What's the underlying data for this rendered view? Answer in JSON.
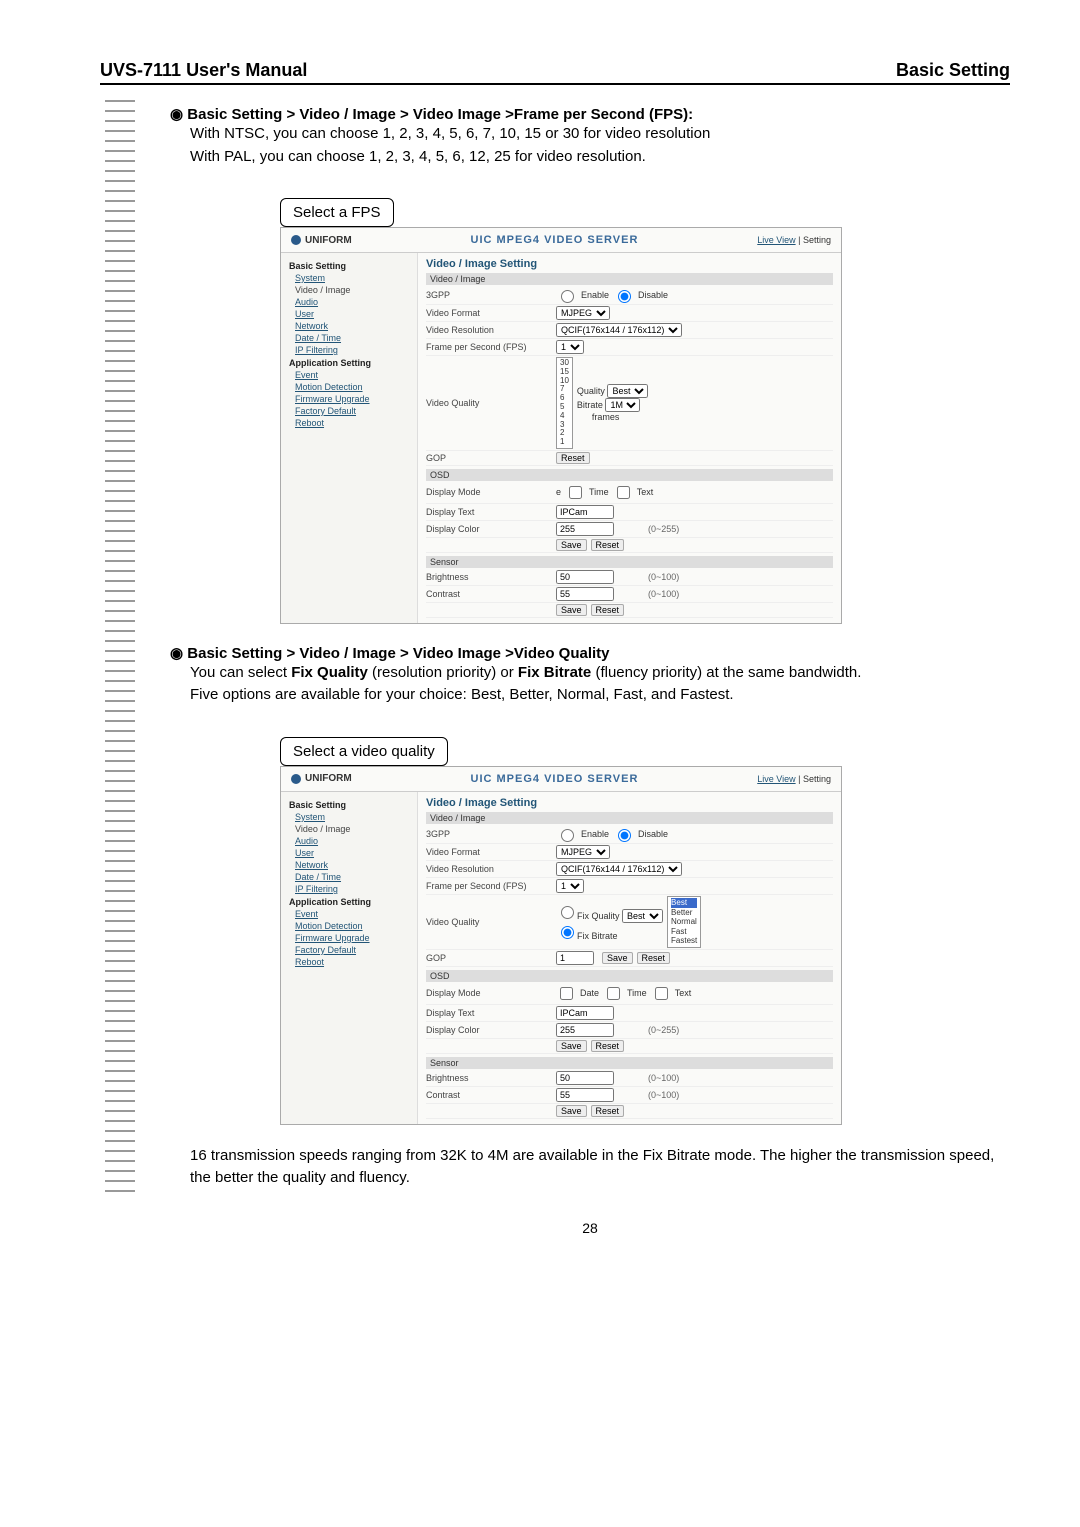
{
  "header": {
    "left": "UVS-7111 User's Manual",
    "right": "Basic Setting"
  },
  "fps_section": {
    "title": "Basic Setting > Video / Image > Video Image >Frame per Second (FPS):",
    "line1": "With NTSC, you can choose 1, 2, 3, 4, 5, 6, 7, 10, 15 or 30 for video resolution",
    "line2": "With PAL, you can choose 1, 2, 3, 4, 5, 6, 12, 25 for video resolution.",
    "callout": "Select a FPS"
  },
  "quality_section": {
    "title": "Basic Setting > Video / Image > Video Image >Video Quality",
    "line1": "You can select Fix Quality (resolution priority) or Fix Bitrate (fluency priority) at the same bandwidth.",
    "line2": "Five options are available for your choice: Best, Better, Normal, Fast, and Fastest.",
    "callout": "Select a video quality",
    "footer": "16 transmission speeds ranging from 32K to 4M are available in the Fix Bitrate mode. The higher the transmission speed, the better the quality and fluency."
  },
  "screenshot": {
    "logo": "UNIFORM",
    "server_title": "UIC MPEG4 VIDEO SERVER",
    "live_view": "Live View",
    "setting": "Setting",
    "nav": {
      "basic": "Basic Setting",
      "system": "System",
      "video": "Video / Image",
      "audio": "Audio",
      "user": "User",
      "network": "Network",
      "datetime": "Date / Time",
      "ipfilter": "IP Filtering",
      "app": "Application Setting",
      "event": "Event",
      "motion": "Motion Detection",
      "firmware": "Firmware Upgrade",
      "factory": "Factory Default",
      "reboot": "Reboot"
    },
    "main": {
      "title": "Video / Image Setting",
      "video_image": "Video / Image",
      "gpp": "3GPP",
      "enable": "Enable",
      "disable": "Disable",
      "video_format": "Video Format",
      "format_val": "MJPEG",
      "video_res": "Video Resolution",
      "res_val": "QCIF(176x144 / 176x112)",
      "fps": "Frame per Second (FPS)",
      "fps_val": "1",
      "fps_options": [
        "30",
        "15",
        "10",
        "7",
        "6",
        "5",
        "4",
        "3",
        "2",
        "1"
      ],
      "video_quality": "Video Quality",
      "quality_label": "Quality",
      "quality_val": "Best",
      "bitrate": "Bitrate",
      "bitrate_val": "1M",
      "frames": "frames",
      "fix_quality": "Fix Quality",
      "fix_bitrate": "Fix Bitrate",
      "quality_options": [
        "Best",
        "Better",
        "Normal",
        "Fast",
        "Fastest"
      ],
      "gop": "GOP",
      "gop_val": "1",
      "osd": "OSD",
      "display_mode": "Display Mode",
      "mode_date": "Date",
      "mode_time": "Time",
      "mode_text": "Text",
      "display_text": "Display Text",
      "text_val": "IPCam",
      "display_color": "Display Color",
      "color_val": "255",
      "color_range": "(0~255)",
      "sensor": "Sensor",
      "brightness": "Brightness",
      "brightness_val": "50",
      "brightness_range": "(0~100)",
      "contrast": "Contrast",
      "contrast_val": "55",
      "contrast_range": "(0~100)",
      "save": "Save",
      "reset": "Reset"
    }
  },
  "page_number": "28"
}
